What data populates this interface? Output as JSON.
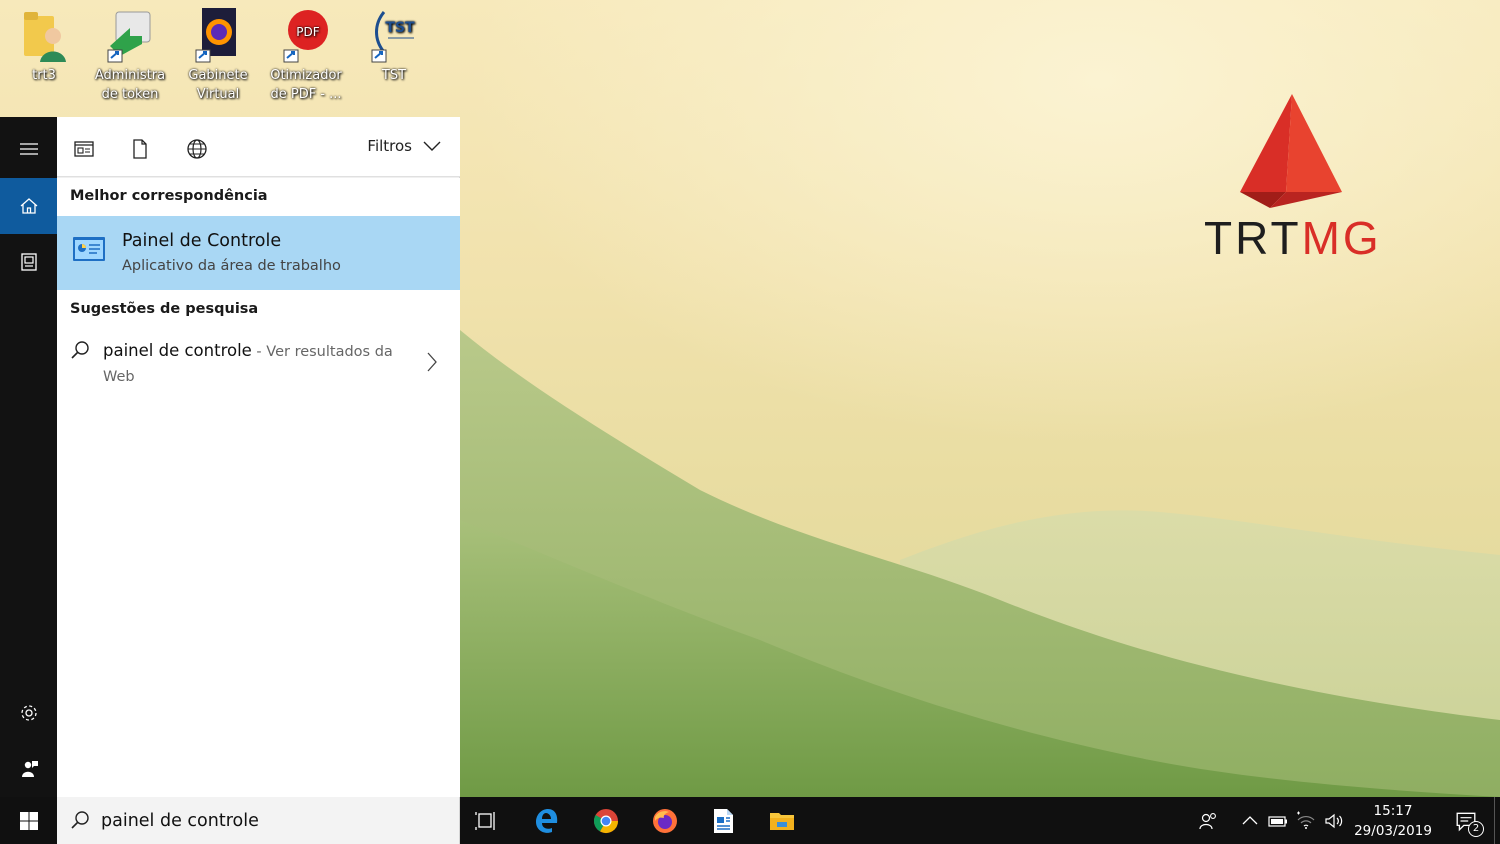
{
  "desktop": {
    "icons": [
      {
        "label": "trt3",
        "icon": "user-folder-icon"
      },
      {
        "label": "Administra\nde token",
        "icon": "token-manager-icon"
      },
      {
        "label": "Gabinete\nVirtual",
        "icon": "firefox-shortcut-icon"
      },
      {
        "label": "Otimizador\nde PDF - ...",
        "icon": "pdf-optimizer-icon"
      },
      {
        "label": "TST",
        "icon": "tst-shortcut-icon"
      }
    ],
    "logo": {
      "part1": "TRT",
      "part2": "MG",
      "colors": {
        "dark": "#1e1e1e",
        "red": "#d92e27"
      }
    }
  },
  "start_rail": {
    "items": [
      "hamburger-menu-icon",
      "home-icon",
      "notebook-icon",
      "settings-icon",
      "feedback-icon"
    ],
    "active": "home-icon",
    "accent": "#0f5b9e"
  },
  "search_panel": {
    "scopes": [
      "apps-scope-icon",
      "documents-scope-icon",
      "web-scope-icon"
    ],
    "filters_label": "Filtros",
    "best_match_header": "Melhor correspondência",
    "best_match": {
      "title": "Painel de Controle",
      "subtitle": "Aplicativo da área de trabalho",
      "highlight": "#a9d7f4"
    },
    "suggestions_header": "Sugestões de pesquisa",
    "suggestion": {
      "query": "painel de controle",
      "hint": " - Ver resultados da Web"
    }
  },
  "search_box": {
    "value": "painel de controle"
  },
  "taskbar": {
    "apps": [
      "task-view-icon",
      "edge-icon",
      "chrome-icon",
      "firefox-icon",
      "document-editor-icon",
      "file-explorer-icon"
    ],
    "tray": [
      "people-icon",
      "chevron-up-icon",
      "battery-icon",
      "wifi-icon",
      "volume-icon"
    ],
    "time": "15:17",
    "date": "29/03/2019",
    "notifications": "2"
  }
}
